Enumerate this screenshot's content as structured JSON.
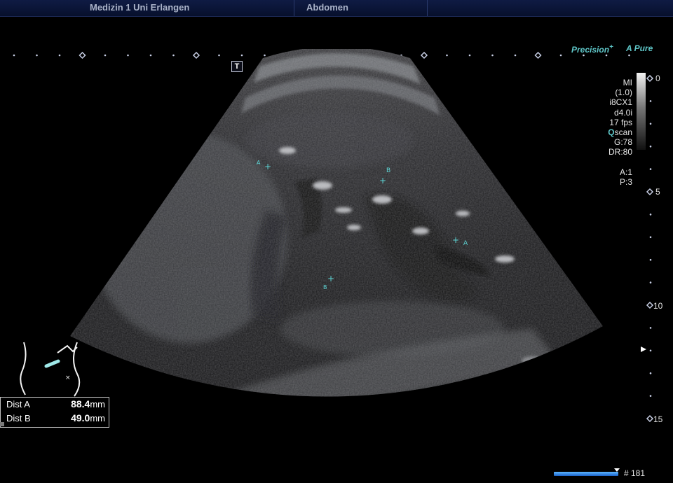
{
  "header": {
    "institution": "Medizin 1 Uni Erlangen",
    "preset": "Abdomen"
  },
  "brand": {
    "precision": "Precision",
    "precision_suffix": "+",
    "pure_a": "A",
    "pure_label": "Pure"
  },
  "transducer_badge": "T",
  "scan_info": {
    "mi_label": "MI",
    "mi_value": "(1.0)",
    "probe": "i8CX1",
    "depth_setting": "d4.0i",
    "frame_rate": "17 fps",
    "qscan_q": "Q",
    "qscan_rest": "scan",
    "gain": "G:78",
    "dynamic_range": "DR:80",
    "a_setting": "A:1",
    "p_setting": "P:3"
  },
  "depth_scale": {
    "labels": [
      "0",
      "5",
      "10",
      "15"
    ]
  },
  "calipers": {
    "a_start": "A",
    "a_end": "A",
    "b_start": "B",
    "b_end": "B"
  },
  "measurements": [
    {
      "label": "Dist A",
      "value": "88.4",
      "unit": "mm"
    },
    {
      "label": "Dist B",
      "value": "49.0",
      "unit": "mm"
    }
  ],
  "frame": {
    "number": "# 181"
  },
  "colors": {
    "caliper": "#5ed6d6",
    "header_bg": "#0f1b44",
    "header_text": "#aab3c9",
    "accent": "#5fc7c9",
    "cine_bar": "#2a7ae0"
  }
}
